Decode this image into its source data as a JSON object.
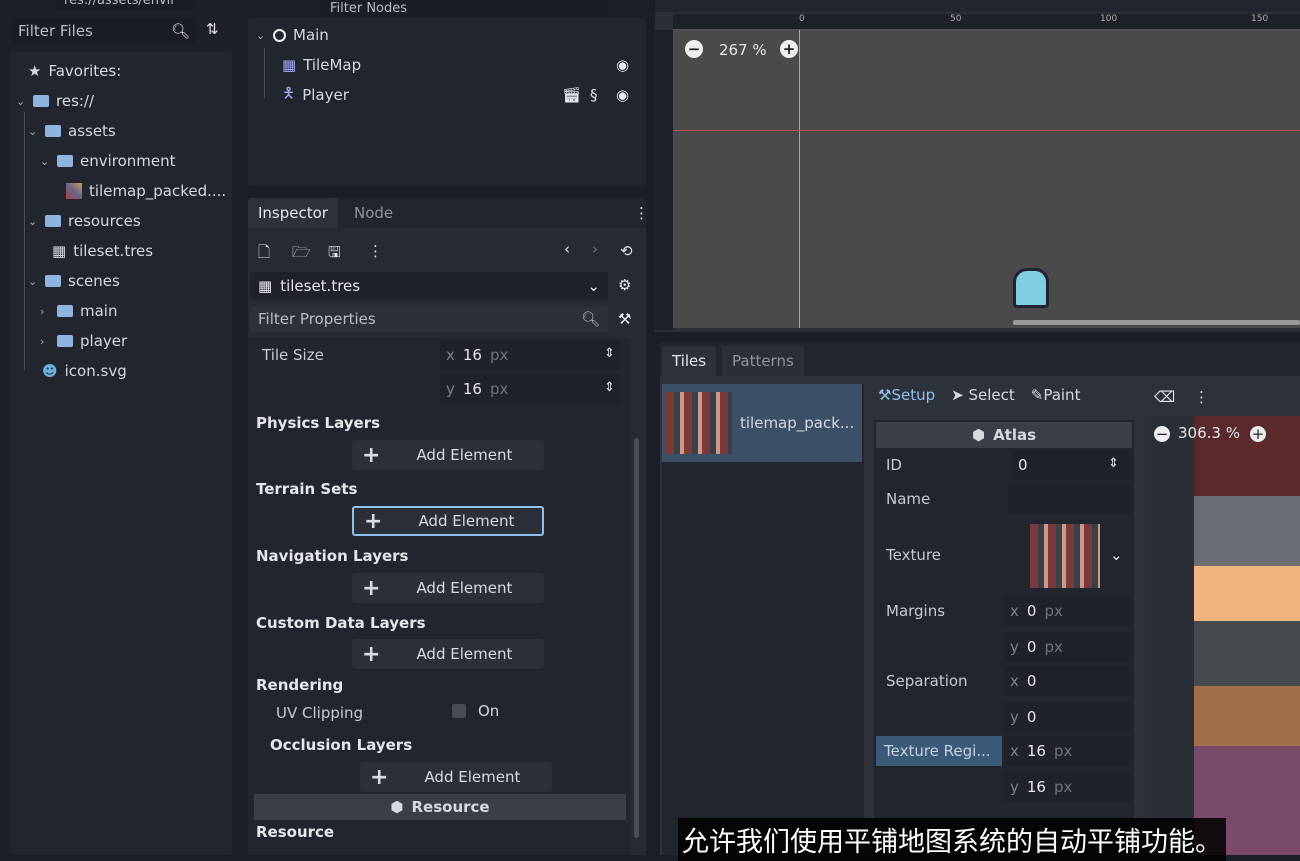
{
  "filesystem": {
    "path_value": "res://assets/envir",
    "filter_placeholder": "Filter Files",
    "items": [
      {
        "label": "Favorites:",
        "icon": "star-icon"
      },
      {
        "label": "res://",
        "icon": "folder-icon"
      },
      {
        "label": "assets",
        "icon": "folder-icon"
      },
      {
        "label": "environment",
        "icon": "folder-icon"
      },
      {
        "label": "tilemap_packed....",
        "icon": "image-icon"
      },
      {
        "label": "resources",
        "icon": "folder-icon"
      },
      {
        "label": "tileset.tres",
        "icon": "tileset-icon"
      },
      {
        "label": "scenes",
        "icon": "folder-icon"
      },
      {
        "label": "main",
        "icon": "folder-icon"
      },
      {
        "label": "player",
        "icon": "folder-icon"
      },
      {
        "label": "icon.svg",
        "icon": "godot-icon"
      }
    ]
  },
  "scene": {
    "filter_placeholder": "Filter Nodes",
    "nodes": [
      {
        "label": "Main",
        "icon": "node2d-icon"
      },
      {
        "label": "TileMap",
        "icon": "tilemap-icon"
      },
      {
        "label": "Player",
        "icon": "character-icon"
      }
    ]
  },
  "inspector": {
    "tabs": [
      "Inspector",
      "Node"
    ],
    "resource_name": "tileset.tres",
    "filter_placeholder": "Filter Properties",
    "tile_size_label": "Tile Size",
    "tile_size_x": "16",
    "tile_size_y": "16",
    "unit": "px",
    "axis_x": "x",
    "axis_y": "y",
    "sections": {
      "physics": "Physics Layers",
      "terrain": "Terrain Sets",
      "navigation": "Navigation Layers",
      "custom": "Custom Data Layers",
      "rendering": "Rendering",
      "occlusion": "Occlusion Layers",
      "resource": "Resource"
    },
    "add_element": "Add Element",
    "uv_clipping_label": "UV Clipping",
    "uv_clipping_value": "On",
    "resource_header": "Resource"
  },
  "viewport": {
    "zoom": "267 %",
    "ruler_labels": [
      "0",
      "50",
      "100",
      "150"
    ]
  },
  "tiles_panel": {
    "tabs": [
      "Tiles",
      "Patterns"
    ],
    "source_name": "tilemap_pack...",
    "modes": [
      "Setup",
      "Select",
      "Paint"
    ],
    "atlas_header": "Atlas",
    "id_label": "ID",
    "id_value": "0",
    "name_label": "Name",
    "texture_label": "Texture",
    "margins_label": "Margins",
    "margins_x": "0",
    "margins_y": "0",
    "separation_label": "Separation",
    "separation_x": "0",
    "separation_y": "0",
    "region_label": "Texture Regi...",
    "region_x": "16",
    "region_y": "16",
    "unit": "px",
    "atlas_zoom": "306.3 %"
  },
  "subtitle": "允许我们使用平铺地图系统的自动平铺功能。"
}
